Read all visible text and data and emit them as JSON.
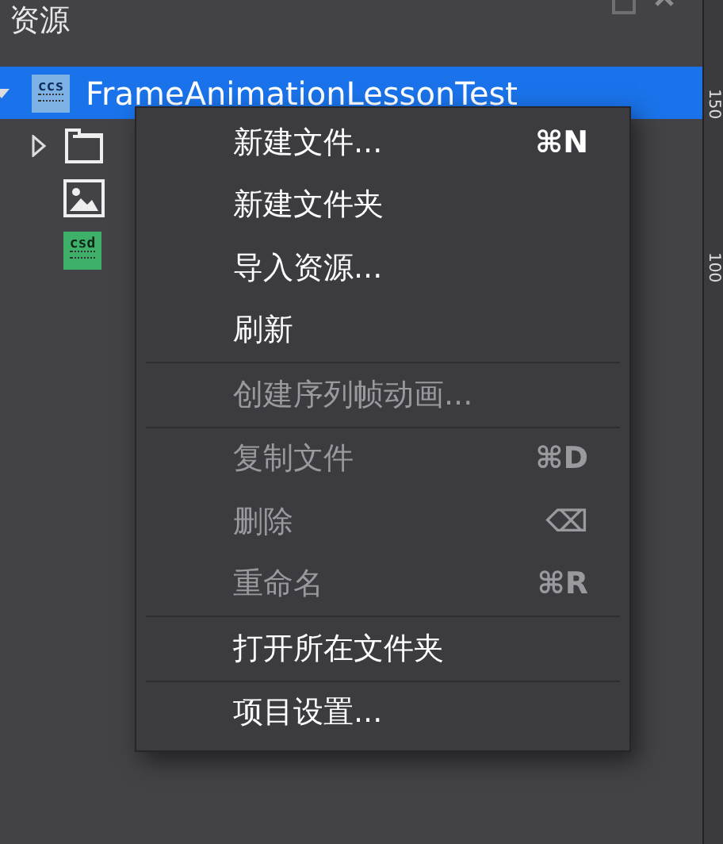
{
  "panel": {
    "title": "资源"
  },
  "tree": [
    {
      "label": "FrameAnimationLessonTest",
      "kind": "ccs",
      "icon_text": "ccs",
      "selected": true,
      "expanded": true,
      "children": [
        {
          "kind": "folder",
          "expanded": false,
          "selected": false
        },
        {
          "kind": "image",
          "selected": false
        },
        {
          "kind": "csd",
          "icon_text": "csd",
          "selected": false
        }
      ]
    }
  ],
  "ruler": {
    "labels": [
      "150",
      "100"
    ]
  },
  "context_menu": [
    {
      "kind": "item",
      "label": "新建文件...",
      "shortcut": "⌘N",
      "disabled": false
    },
    {
      "kind": "item",
      "label": "新建文件夹",
      "disabled": false
    },
    {
      "kind": "item",
      "label": "导入资源...",
      "disabled": false
    },
    {
      "kind": "item",
      "label": "刷新",
      "disabled": false
    },
    {
      "kind": "separator"
    },
    {
      "kind": "item",
      "label": "创建序列帧动画...",
      "disabled": true
    },
    {
      "kind": "separator"
    },
    {
      "kind": "item",
      "label": "复制文件",
      "shortcut": "⌘D",
      "disabled": true
    },
    {
      "kind": "item",
      "label": "删除",
      "shortcut": "⌫",
      "disabled": true
    },
    {
      "kind": "item",
      "label": "重命名",
      "shortcut": "⌘R",
      "disabled": true
    },
    {
      "kind": "separator"
    },
    {
      "kind": "item",
      "label": "打开所在文件夹",
      "disabled": false
    },
    {
      "kind": "separator"
    },
    {
      "kind": "item",
      "label": "项目设置...",
      "disabled": false
    }
  ]
}
